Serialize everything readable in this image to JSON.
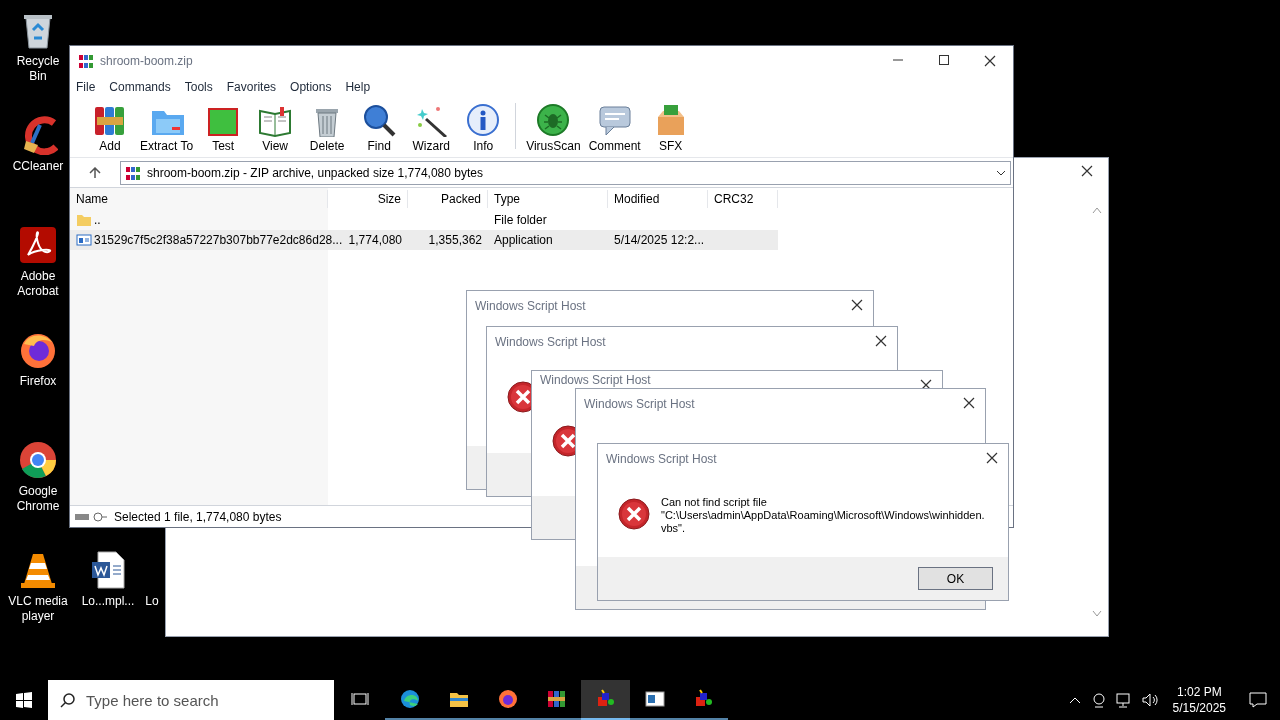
{
  "desktop_icons": [
    {
      "label": "Recycle Bin",
      "kind": "recycle"
    },
    {
      "label": "CCleaner",
      "kind": "ccleaner"
    },
    {
      "label": "Adobe Acrobat",
      "kind": "acrobat"
    },
    {
      "label": "Firefox",
      "kind": "firefox"
    },
    {
      "label": "Google Chrome",
      "kind": "chrome"
    },
    {
      "label": "VLC media player",
      "kind": "vlc"
    },
    {
      "label": "Lo...mpl...",
      "kind": "word"
    },
    {
      "label": "Lo",
      "kind": "blank"
    }
  ],
  "archiver": {
    "title": "shroom-boom.zip",
    "menu": [
      "File",
      "Commands",
      "Tools",
      "Favorites",
      "Options",
      "Help"
    ],
    "toolbar": [
      {
        "label": "Add",
        "kind": "add"
      },
      {
        "label": "Extract To",
        "kind": "extract"
      },
      {
        "label": "Test",
        "kind": "test"
      },
      {
        "label": "View",
        "kind": "view"
      },
      {
        "label": "Delete",
        "kind": "delete"
      },
      {
        "label": "Find",
        "kind": "find"
      },
      {
        "label": "Wizard",
        "kind": "wizard"
      },
      {
        "label": "Info",
        "kind": "info"
      },
      {
        "label": "VirusScan",
        "kind": "virus"
      },
      {
        "label": "Comment",
        "kind": "comment"
      },
      {
        "label": "SFX",
        "kind": "sfx"
      }
    ],
    "address": "shroom-boom.zip - ZIP archive, unpacked size 1,774,080 bytes",
    "columns": [
      "Name",
      "Size",
      "Packed",
      "Type",
      "Modified",
      "CRC32"
    ],
    "rows": [
      {
        "kind": "folder",
        "name": "..",
        "size": "",
        "packed": "",
        "type": "File folder",
        "modified": "",
        "selected": false
      },
      {
        "kind": "app",
        "name": "31529c7f5c2f38a57227b307bb77e2dc86d28...",
        "size": "1,774,080",
        "packed": "1,355,362",
        "type": "Application",
        "modified": "5/14/2025 12:2...",
        "selected": true
      }
    ],
    "status": "Selected 1 file, 1,774,080 bytes"
  },
  "dialogs": [
    {
      "title": "Windows Script Host"
    },
    {
      "title": "Windows Script Host"
    },
    {
      "title": "Windows Script Host"
    },
    {
      "title": "Windows Script Host"
    },
    {
      "title": "Windows Script Host",
      "message": "Can not find script file \"C:\\Users\\admin\\AppData\\Roaming\\Microsoft\\Windows\\winhidden.vbs\".",
      "button": "OK"
    }
  ],
  "taskbar": {
    "search_placeholder": "Type here to search",
    "apps": [
      {
        "kind": "taskview",
        "active": false
      },
      {
        "kind": "edge",
        "active": false
      },
      {
        "kind": "explorer",
        "active": false
      },
      {
        "kind": "firefox",
        "active": false
      },
      {
        "kind": "winrar",
        "active": false
      },
      {
        "kind": "script",
        "active": true
      },
      {
        "kind": "window",
        "active": false
      },
      {
        "kind": "script",
        "active": false
      }
    ],
    "time": "1:02 PM",
    "date": "5/15/2025"
  }
}
